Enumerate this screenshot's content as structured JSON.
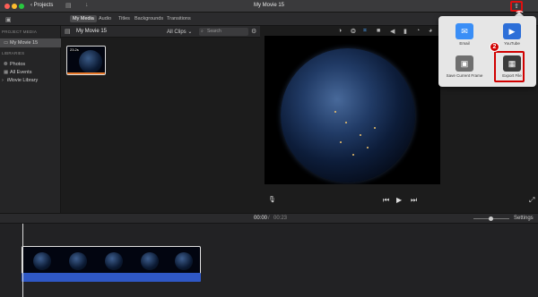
{
  "window": {
    "title": "My Movie 15",
    "projects_label": "Projects",
    "share_icon": "share-icon"
  },
  "annotations": {
    "step1": "1",
    "step2": "2",
    "highlight_color": "#d00000"
  },
  "library_tabs": [
    "My Media",
    "Audio",
    "Titles",
    "Backgrounds",
    "Transitions"
  ],
  "sidebar": {
    "project_media_heading": "PROJECT MEDIA",
    "project_item": "My Movie 15",
    "libraries_heading": "LIBRARIES",
    "library_items": [
      "Photos",
      "All Events",
      "iMovie Library"
    ]
  },
  "browser": {
    "title": "My Movie 15",
    "filter": "All Clips",
    "search_placeholder": "Search",
    "clip_duration": "23.2s"
  },
  "viewer": {
    "tools": [
      "wand-icon",
      "color-balance-icon",
      "color-correction-icon",
      "crop-icon",
      "stabilize-icon",
      "volume-icon",
      "noise-reduction-icon",
      "speed-icon",
      "filter-icon",
      "info-icon"
    ]
  },
  "share_menu": {
    "items": [
      {
        "label": "Email",
        "icon": "email-icon",
        "color": "#3a8ef6"
      },
      {
        "label": "YouTube",
        "icon": "youtube-icon",
        "color": "#2d6fd8"
      },
      {
        "label": "Save Current Frame",
        "icon": "image-icon",
        "color": "#6f6f6f"
      },
      {
        "label": "Export File",
        "icon": "film-icon",
        "color": "#3b3b3b"
      }
    ]
  },
  "timeline": {
    "current_time": "00:00",
    "separator": "/",
    "total_time": "00:23",
    "settings_label": "Settings",
    "audio_color": "#2f58c6"
  }
}
